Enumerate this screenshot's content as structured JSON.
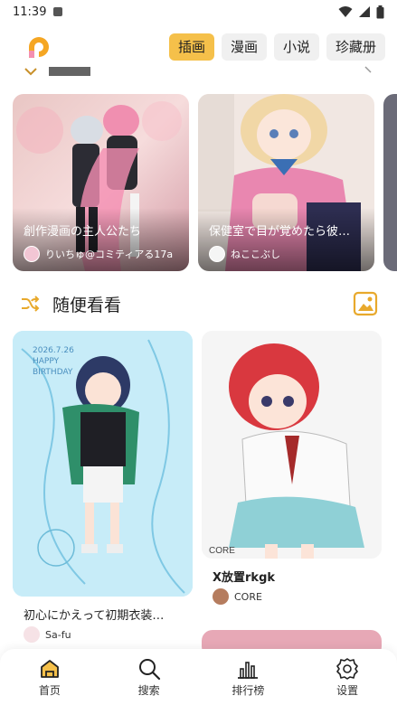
{
  "status_bar": {
    "time": "11:39",
    "icons": [
      "notification-a-icon",
      "wifi-icon",
      "signal-icon",
      "battery-icon"
    ]
  },
  "header": {
    "logo": "app-logo",
    "tabs": [
      {
        "label": "插画",
        "active": true
      },
      {
        "label": "漫画",
        "active": false
      },
      {
        "label": "小说",
        "active": false
      },
      {
        "label": "珍藏册",
        "active": false
      }
    ]
  },
  "ranking": {
    "cards": [
      {
        "title": "創作漫画の主人公たち",
        "author": "りいちゅ@コミティアる17a"
      },
      {
        "title": "保健室で目が覚めたら彼…",
        "author": "ねここぶし"
      }
    ]
  },
  "random_section": {
    "title": "随便看看",
    "shuffle_icon": "shuffle-icon",
    "gallery_icon": "gallery-icon"
  },
  "feed": {
    "left": {
      "title": "初心にかえって初期衣装…",
      "author": "Sa-fu",
      "art_text": "2026.7.26 HAPPY BIRTHDAY"
    },
    "right": {
      "title": "X放置rkgk",
      "author": "CORE"
    }
  },
  "bottom_nav": {
    "items": [
      {
        "label": "首页",
        "icon": "home-icon"
      },
      {
        "label": "搜索",
        "icon": "search-icon"
      },
      {
        "label": "排行榜",
        "icon": "bar-chart-icon"
      },
      {
        "label": "设置",
        "icon": "gear-icon"
      }
    ]
  },
  "colors": {
    "accent": "#f5c04a",
    "tab_inactive": "#f0f0f0",
    "text": "#222222"
  }
}
